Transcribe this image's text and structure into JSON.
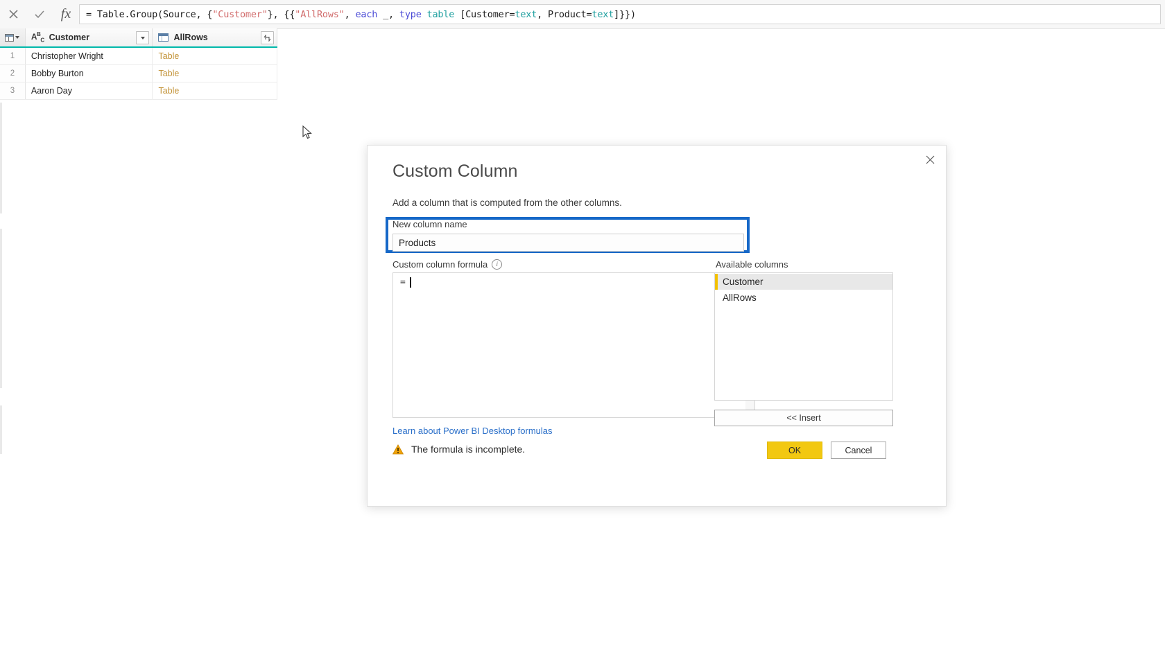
{
  "formula_bar": {
    "cancel_icon": "close-icon",
    "commit_icon": "checkmark-icon",
    "fx_label": "fx",
    "tokens": [
      {
        "text": "= Table.Group(Source, {",
        "type": "plain"
      },
      {
        "text": "\"Customer\"",
        "type": "string"
      },
      {
        "text": "}, {{",
        "type": "plain"
      },
      {
        "text": "\"AllRows\"",
        "type": "string"
      },
      {
        "text": ", ",
        "type": "plain"
      },
      {
        "text": "each",
        "type": "keyword"
      },
      {
        "text": " _, ",
        "type": "plain"
      },
      {
        "text": "type",
        "type": "keyword"
      },
      {
        "text": " ",
        "type": "plain"
      },
      {
        "text": "table",
        "type": "type"
      },
      {
        "text": " [Customer=",
        "type": "plain"
      },
      {
        "text": "text",
        "type": "type"
      },
      {
        "text": ", Product=",
        "type": "plain"
      },
      {
        "text": "text",
        "type": "type"
      },
      {
        "text": "]}})",
        "type": "plain"
      }
    ],
    "full_text": "= Table.Group(Source, {\"Customer\"}, {{\"AllRows\", each _, type table [Customer=text, Product=text]}})"
  },
  "grid": {
    "columns": [
      {
        "name": "Customer",
        "type_icon": "abc-text-icon",
        "has_filter_dropdown": true
      },
      {
        "name": "AllRows",
        "type_icon": "table-icon",
        "has_expand_button": true
      }
    ],
    "rows": [
      {
        "num": "1",
        "customer": "Christopher Wright",
        "allrows": "Table"
      },
      {
        "num": "2",
        "customer": "Bobby Burton",
        "allrows": "Table"
      },
      {
        "num": "3",
        "customer": "Aaron Day",
        "allrows": "Table"
      }
    ],
    "header_accent_color": "#00b8aa",
    "table_link_color": "#c39338"
  },
  "dialog": {
    "title": "Custom Column",
    "subtitle": "Add a column that is computed from the other columns.",
    "close_label": "✕",
    "new_column_name": {
      "label": "New column name",
      "value": "Products",
      "placeholder": "",
      "highlight_color": "#1668c8"
    },
    "custom_column_formula": {
      "label": "Custom column formula",
      "info_glyph": "i",
      "value": "="
    },
    "learn_link": "Learn about Power BI Desktop formulas",
    "available_columns": {
      "label": "Available columns",
      "items": [
        {
          "label": "Customer",
          "selected": true
        },
        {
          "label": "AllRows",
          "selected": false
        }
      ],
      "selection_accent": "#f2c100"
    },
    "insert_button": "<< Insert",
    "status": {
      "message": "The formula is incomplete.",
      "icon": "warning-icon"
    },
    "ok_button": "OK",
    "cancel_button": "Cancel",
    "ok_color": "#f2c811"
  }
}
